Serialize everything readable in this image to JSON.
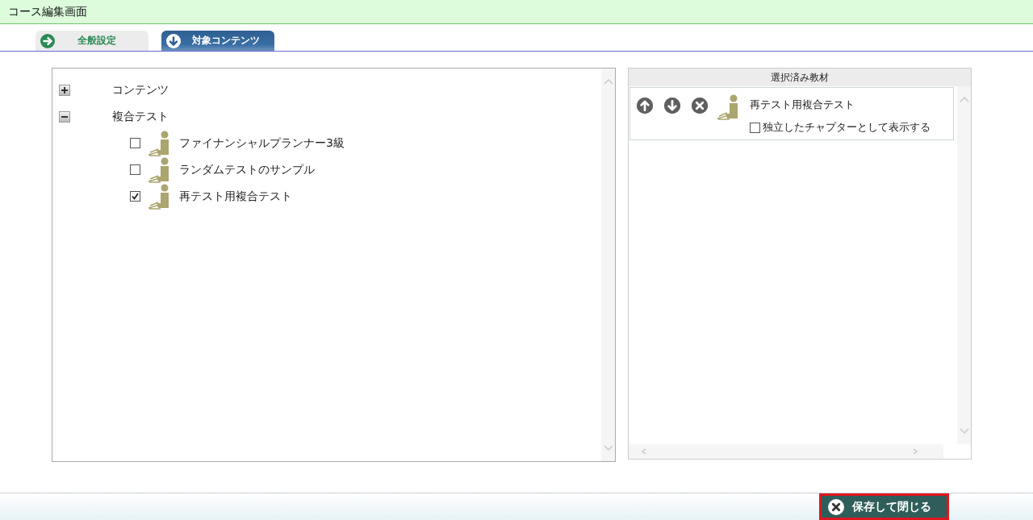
{
  "window": {
    "title": "コース編集画面"
  },
  "tabs": [
    {
      "label": "全般設定",
      "selected": false,
      "kind": "general"
    },
    {
      "label": "対象コンテンツ",
      "selected": true,
      "kind": "contents"
    }
  ],
  "tree": [
    {
      "label": "コンテンツ",
      "expanded": false
    },
    {
      "label": "複合テスト",
      "expanded": true,
      "children": [
        {
          "label": "ファイナンシャルプランナー3級",
          "checked": false
        },
        {
          "label": "ランダムテストのサンプル",
          "checked": false
        },
        {
          "label": "再テスト用複合テスト",
          "checked": true
        }
      ]
    }
  ],
  "selected_panel": {
    "title": "選択済み教材",
    "items": [
      {
        "label": "再テスト用複合テスト",
        "option": {
          "label": "独立したチャプターとして表示する",
          "checked": false
        }
      }
    ]
  },
  "footer": {
    "save_button": "保存して閉じる"
  }
}
